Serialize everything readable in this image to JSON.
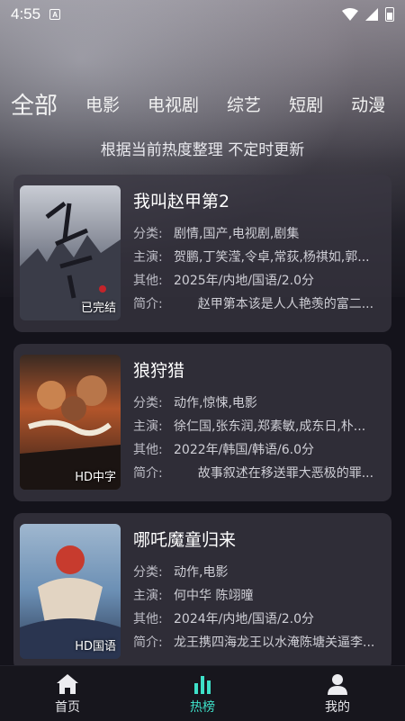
{
  "status": {
    "time": "4:55",
    "a_badge": "A"
  },
  "tabs": [
    "全部",
    "电影",
    "电视剧",
    "综艺",
    "短剧",
    "动漫"
  ],
  "subtitle": "根据当前热度整理 不定时更新",
  "labels": {
    "category": "分类:",
    "cast": "主演:",
    "other": "其他:",
    "intro": "简介:"
  },
  "cards": [
    {
      "title": "我叫赵甲第2",
      "badge": "已完结",
      "category": "剧情,国产,电视剧,剧集",
      "cast": "贺鹏,丁笑滢,令卓,常荻,杨祺如,郭...",
      "other": "2025年/内地/国语/2.0分",
      "intro": "      赵甲第本该是人人艳羡的富二..."
    },
    {
      "title": "狼狩猎",
      "badge": "HD中字",
      "category": "动作,惊悚,电影",
      "cast": "徐仁国,张东润,郑素敏,成东日,朴...",
      "other": "2022年/韩国/韩语/6.0分",
      "intro": "      故事叙述在移送罪大恶极的罪..."
    },
    {
      "title": "哪吒魔童归来",
      "badge": "HD国语",
      "category": "动作,电影",
      "cast": "何中华 陈翊曈",
      "other": "2024年/内地/国语/2.0分",
      "intro": "龙王携四海龙王以水淹陈塘关逼李..."
    }
  ],
  "nav": {
    "home": "首页",
    "hot": "热榜",
    "mine": "我的"
  },
  "colors": {
    "accent": "#3ee0c8",
    "background": "#14131b"
  }
}
